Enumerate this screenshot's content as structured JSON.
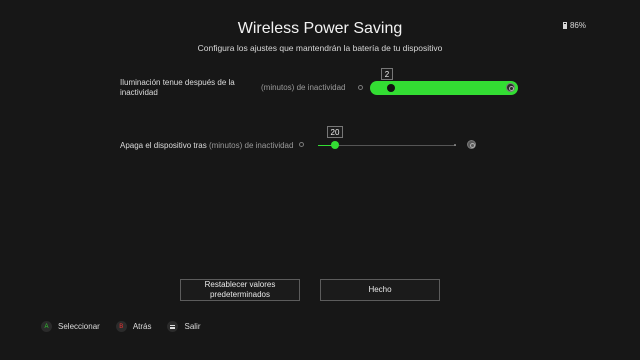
{
  "status": {
    "battery": "86%"
  },
  "header": {
    "title": "Wireless Power Saving",
    "subtitle": "Configura los ajustes que mantendrán la batería de tu dispositivo"
  },
  "settings": [
    {
      "label_line1": "Iluminación tenue después de la",
      "label_line2": "inactividad",
      "unit": "(minutos) de inactividad",
      "value": "2",
      "fraction": 0.1
    },
    {
      "label_main": "Apaga el dispositivo tras",
      "unit": "(minutos) de inactividad",
      "value": "20",
      "fraction": 0.12
    }
  ],
  "buttons": {
    "reset_line1": "Restablecer valores",
    "reset_line2": "predeterminados",
    "done": "Hecho"
  },
  "hints": [
    {
      "key": "A",
      "label": "Seleccionar"
    },
    {
      "key": "B",
      "label": "Atrás"
    },
    {
      "key": "",
      "label": "Salir"
    }
  ],
  "colors": {
    "accent": "#33dd33",
    "background": "#171717"
  }
}
